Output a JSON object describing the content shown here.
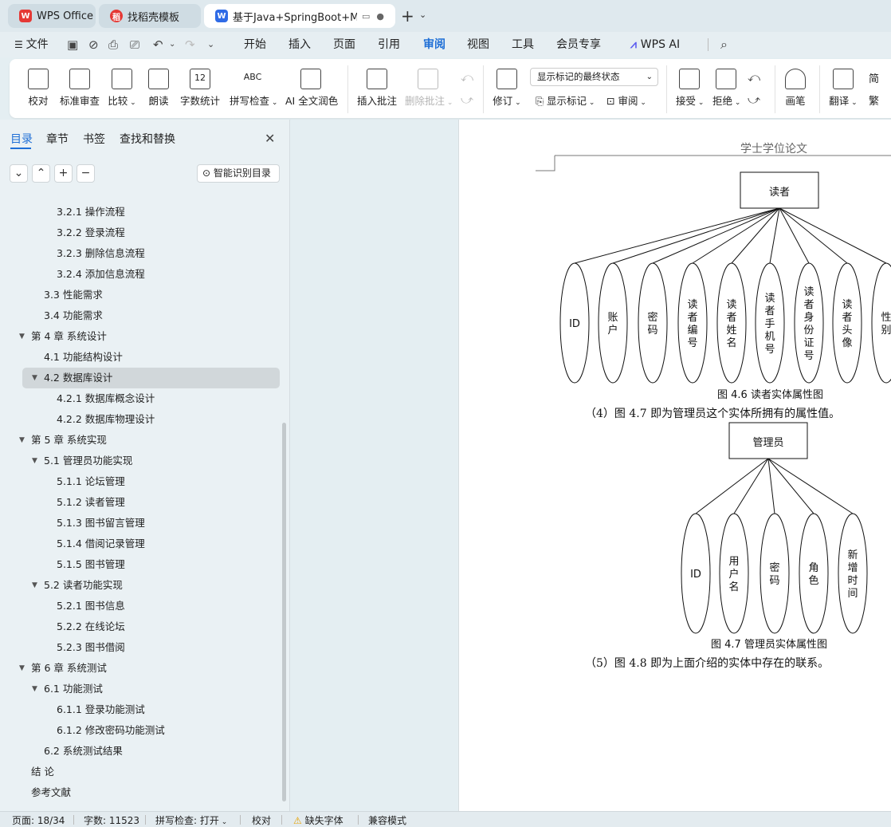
{
  "tabs": [
    {
      "label": "WPS Office"
    },
    {
      "label": "找稻壳模板"
    },
    {
      "label": "基于Java+SpringBoot+MyS"
    }
  ],
  "menu": [
    "文件",
    "开始",
    "插入",
    "页面",
    "引用",
    "审阅",
    "视图",
    "工具",
    "会员专享",
    "WPS AI"
  ],
  "menu_active": "审阅",
  "ribbon": {
    "buttons": [
      "校对",
      "标准审查",
      "比较",
      "朗读",
      "字数统计",
      "拼写检查",
      "AI 全文润色",
      "插入批注",
      "删除批注",
      "修订",
      "接受",
      "拒绝",
      "画笔",
      "翻译"
    ],
    "markup_select": "显示标记的最终状态",
    "show_markup": "显示标记",
    "review": "审阅",
    "chinese_simplified": "简",
    "chinese_traditional": "繁",
    "word_count_icon_text": "12",
    "spell_icon_text": "ABC"
  },
  "nav": {
    "tabs": [
      "目录",
      "章节",
      "书签",
      "查找和替换"
    ],
    "smart_btn": "智能识别目录",
    "items": [
      {
        "text": "3.2.1  操作流程"
      },
      {
        "text": "3.2.2  登录流程"
      },
      {
        "text": "3.2.3  删除信息流程"
      },
      {
        "text": "3.2.4  添加信息流程"
      },
      {
        "text": "3.3  性能需求"
      },
      {
        "text": "3.4  功能需求"
      },
      {
        "text": "第 4 章  系统设计"
      },
      {
        "text": "4.1  功能结构设计"
      },
      {
        "text": "4.2  数据库设计"
      },
      {
        "text": "4.2.1  数据库概念设计"
      },
      {
        "text": "4.2.2  数据库物理设计"
      },
      {
        "text": "第 5 章  系统实现"
      },
      {
        "text": "5.1  管理员功能实现"
      },
      {
        "text": "5.1.1  论坛管理"
      },
      {
        "text": "5.1.2  读者管理"
      },
      {
        "text": "5.1.3  图书留言管理"
      },
      {
        "text": "5.1.4  借阅记录管理"
      },
      {
        "text": "5.1.5  图书管理"
      },
      {
        "text": "5.2  读者功能实现"
      },
      {
        "text": "5.2.1  图书信息"
      },
      {
        "text": "5.2.2  在线论坛"
      },
      {
        "text": "5.2.3  图书借阅"
      },
      {
        "text": "第 6 章  系统测试"
      },
      {
        "text": "6.1  功能测试"
      },
      {
        "text": "6.1.1  登录功能测试"
      },
      {
        "text": "6.1.2  修改密码功能测试"
      },
      {
        "text": "6.2  系统测试结果"
      },
      {
        "text": "结    论"
      },
      {
        "text": "参考文献"
      }
    ]
  },
  "doc": {
    "header": "学士学位论文",
    "reader_entity": "读者",
    "reader_attrs": [
      "ID",
      "账户",
      "密码",
      "读者编号",
      "读者姓名",
      "读者手机号",
      "读者身份证号",
      "读者头像",
      "性别"
    ],
    "caption1": "图 4.6  读者实体属性图",
    "para1": "（4）图 4.7 即为管理员这个实体所拥有的属性值。",
    "admin_entity": "管理员",
    "admin_attrs": [
      "ID",
      "用户名",
      "密码",
      "角色",
      "新增时间"
    ],
    "caption2": "图 4.7  管理员实体属性图",
    "para2": "（5）图 4.8 即为上面介绍的实体中存在的联系。"
  },
  "status": {
    "page": "页面: 18/34",
    "words": "字数: 11523",
    "spell": "拼写检查: 打开",
    "proof": "校对",
    "missing_font": "缺失字体",
    "compat": "兼容模式"
  }
}
